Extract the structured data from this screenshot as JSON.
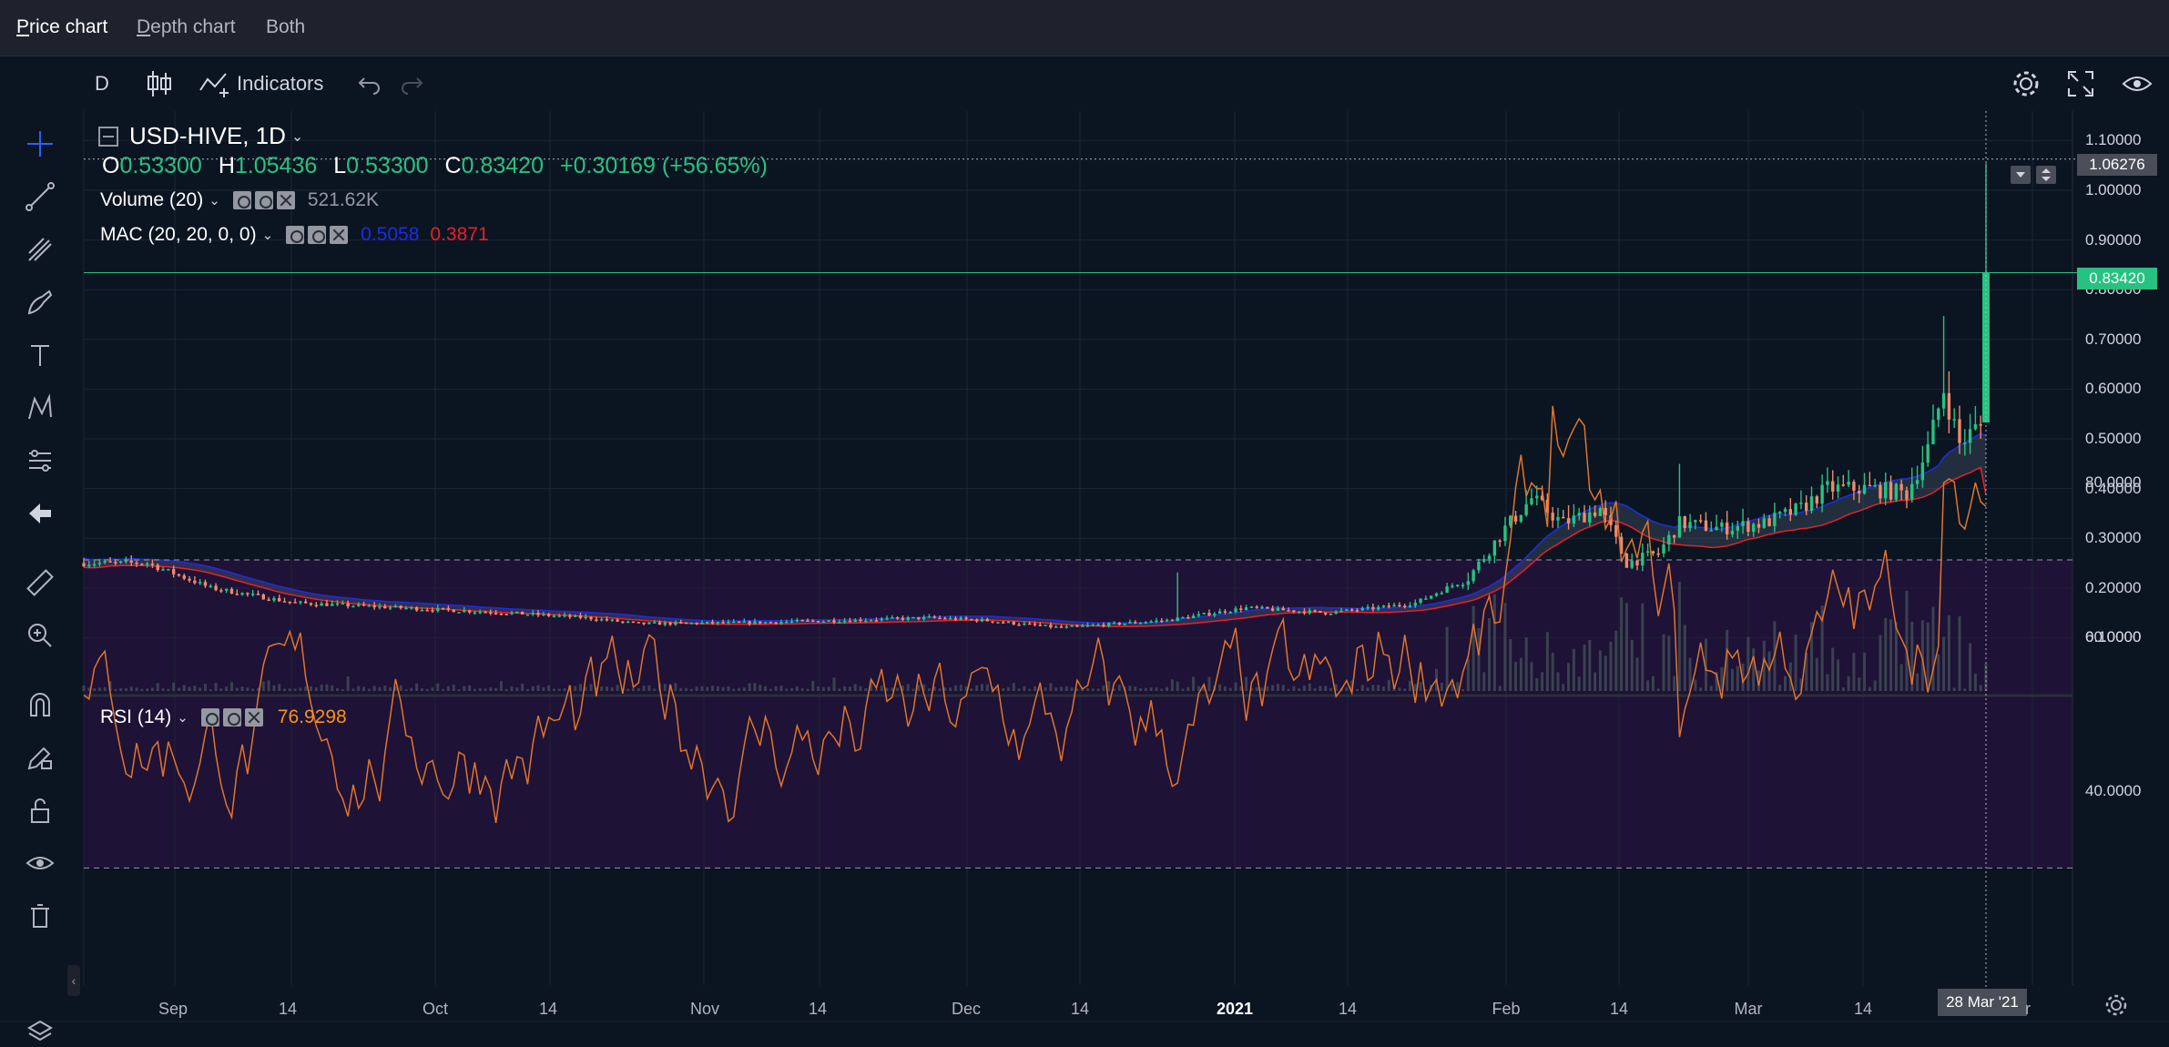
{
  "view_tabs": [
    {
      "label_first": "P",
      "label_rest": "rice chart",
      "active": true
    },
    {
      "label_first": "D",
      "label_rest": "epth chart",
      "active": false
    },
    {
      "label_first": "",
      "label_rest": "Both",
      "active": false
    }
  ],
  "toolbar": {
    "interval": "D",
    "indicators_label": "Indicators"
  },
  "legend": {
    "symbol": "USD-HIVE, 1D",
    "o_label": "O",
    "o_value": "0.53300",
    "h_label": "H",
    "h_value": "1.05436",
    "l_label": "L",
    "l_value": "0.53300",
    "c_label": "C",
    "c_value": "0.83420",
    "change": "+0.30169 (+56.65%)",
    "volume_label": "Volume (20)",
    "volume_value": "521.62K",
    "mac_label": "MAC (20, 20, 0, 0)",
    "mac_upper": "0.5058",
    "mac_lower": "0.3871",
    "rsi_label": "RSI (14)",
    "rsi_value": "76.9298"
  },
  "price_axis": [
    "1.10000",
    "1.00000",
    "0.90000",
    "0.80000",
    "0.70000",
    "0.60000",
    "0.50000",
    "0.40000",
    "0.30000",
    "0.20000",
    "0.10000"
  ],
  "price_badges": {
    "crosshair": "1.06276",
    "last": "0.83420"
  },
  "rsi_axis": [
    "80.0000",
    "60.0000",
    "40.0000"
  ],
  "time_axis": [
    {
      "label": "Sep",
      "bold": false
    },
    {
      "label": "14",
      "bold": false
    },
    {
      "label": "Oct",
      "bold": false
    },
    {
      "label": "14",
      "bold": false
    },
    {
      "label": "Nov",
      "bold": false
    },
    {
      "label": "14",
      "bold": false
    },
    {
      "label": "Dec",
      "bold": false
    },
    {
      "label": "14",
      "bold": false
    },
    {
      "label": "2021",
      "bold": true
    },
    {
      "label": "14",
      "bold": false
    },
    {
      "label": "Feb",
      "bold": false
    },
    {
      "label": "14",
      "bold": false
    },
    {
      "label": "Mar",
      "bold": false
    },
    {
      "label": "14",
      "bold": false
    }
  ],
  "crosshair_date": "28 Mar '21",
  "colors": {
    "up": "#26c281",
    "down": "#ef8a6b",
    "mac_upper": "#1a2ee8",
    "mac_lower": "#e8202a",
    "rsi_line": "#e0752c",
    "rsi_band": "#1e1236",
    "background": "#0b1421"
  },
  "chart_data": {
    "type": "candlestick",
    "title": "USD-HIVE, 1D",
    "ylim": [
      0,
      1.15
    ],
    "rsi_ylim": [
      25,
      95
    ],
    "rsi_band": [
      30,
      70
    ],
    "time_range": [
      "Aug 22 2020",
      "Mar 28 2021"
    ],
    "price_anchors": [
      [
        0,
        0.25
      ],
      [
        12,
        0.25
      ],
      [
        24,
        0.2
      ],
      [
        40,
        0.17
      ],
      [
        60,
        0.16
      ],
      [
        80,
        0.15
      ],
      [
        95,
        0.14
      ],
      [
        105,
        0.128
      ],
      [
        125,
        0.13
      ],
      [
        145,
        0.135
      ],
      [
        160,
        0.14
      ],
      [
        170,
        0.135
      ],
      [
        185,
        0.12
      ],
      [
        205,
        0.135
      ],
      [
        220,
        0.16
      ],
      [
        235,
        0.15
      ],
      [
        245,
        0.16
      ],
      [
        252,
        0.17
      ],
      [
        262,
        0.22
      ],
      [
        269,
        0.32
      ],
      [
        274,
        0.38
      ],
      [
        280,
        0.33
      ],
      [
        287,
        0.36
      ],
      [
        292,
        0.25
      ],
      [
        298,
        0.27
      ],
      [
        302,
        0.33
      ],
      [
        310,
        0.32
      ],
      [
        318,
        0.33
      ],
      [
        325,
        0.36
      ],
      [
        330,
        0.4
      ],
      [
        338,
        0.4
      ],
      [
        345,
        0.39
      ],
      [
        349,
        0.48
      ],
      [
        352,
        0.6
      ],
      [
        355,
        0.49
      ],
      [
        358,
        0.52
      ],
      [
        360,
        0.53
      ]
    ],
    "last_candle": {
      "o": 0.533,
      "h": 1.05436,
      "l": 0.533,
      "c": 0.8342
    }
  }
}
